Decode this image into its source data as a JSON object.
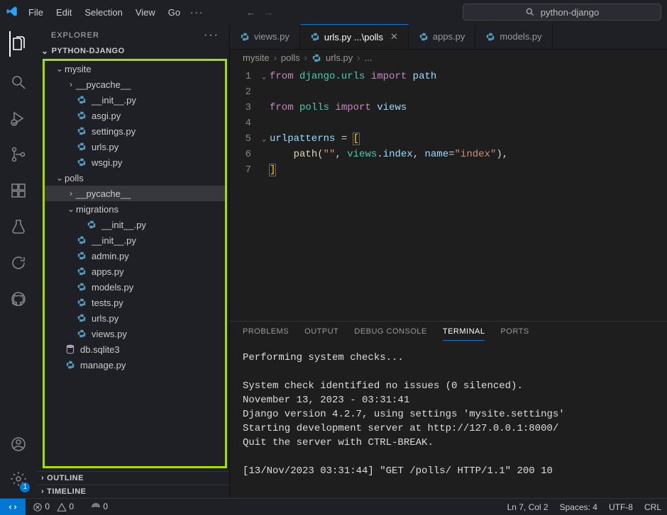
{
  "titlebar": {
    "menu": [
      "File",
      "Edit",
      "Selection",
      "View",
      "Go"
    ],
    "search": "python-django"
  },
  "sidebar": {
    "title": "EXPLORER",
    "project": "PYTHON-DJANGO",
    "outline": "OUTLINE",
    "timeline": "TIMELINE"
  },
  "tree": {
    "mysite": {
      "name": "mysite",
      "type": "folder",
      "open": true
    },
    "mysite_pycache": {
      "name": "__pycache__",
      "type": "folder",
      "open": false
    },
    "mysite_init": {
      "name": "__init__.py",
      "type": "py"
    },
    "asgi": {
      "name": "asgi.py",
      "type": "py"
    },
    "settings": {
      "name": "settings.py",
      "type": "py"
    },
    "mysite_urls": {
      "name": "urls.py",
      "type": "py"
    },
    "wsgi": {
      "name": "wsgi.py",
      "type": "py"
    },
    "polls": {
      "name": "polls",
      "type": "folder",
      "open": true
    },
    "polls_pycache": {
      "name": "__pycache__",
      "type": "folder",
      "open": false,
      "selected": true
    },
    "migrations": {
      "name": "migrations",
      "type": "folder",
      "open": true
    },
    "migrations_init": {
      "name": "__init__.py",
      "type": "py"
    },
    "polls_init": {
      "name": "__init__.py",
      "type": "py"
    },
    "admin": {
      "name": "admin.py",
      "type": "py"
    },
    "apps": {
      "name": "apps.py",
      "type": "py"
    },
    "models": {
      "name": "models.py",
      "type": "py"
    },
    "tests": {
      "name": "tests.py",
      "type": "py"
    },
    "polls_urls": {
      "name": "urls.py",
      "type": "py"
    },
    "views": {
      "name": "views.py",
      "type": "py"
    },
    "db": {
      "name": "db.sqlite3",
      "type": "db"
    },
    "manage": {
      "name": "manage.py",
      "type": "py"
    }
  },
  "tabs": {
    "views": "views.py",
    "urls": "urls.py ...\\polls",
    "apps": "apps.py",
    "models": "models.py"
  },
  "breadcrumbs": [
    "mysite",
    "polls",
    "urls.py",
    "..."
  ],
  "code": {
    "l1": {
      "kw1": "from",
      "mod": "django.urls",
      "kw2": "import",
      "id": "path"
    },
    "l3": {
      "kw1": "from",
      "mod": "polls",
      "kw2": "import",
      "id": "views"
    },
    "l5": {
      "var": "urlpatterns",
      "eq": " = ",
      "b": "["
    },
    "l6": {
      "fn": "path",
      "p1": "(",
      "s": "\"\"",
      "c1": ", ",
      "mod": "views",
      "dot": ".",
      "id": "index",
      "c2": ", ",
      "kw": "name",
      "eq2": "=",
      "s2": "\"index\"",
      "p2": "),"
    },
    "l7": {
      "b": "]"
    }
  },
  "panel": {
    "tabs": [
      "PROBLEMS",
      "OUTPUT",
      "DEBUG CONSOLE",
      "TERMINAL",
      "PORTS"
    ],
    "terminal": "Performing system checks...\n\nSystem check identified no issues (0 silenced).\nNovember 13, 2023 - 03:31:41\nDjango version 4.2.7, using settings 'mysite.settings'\nStarting development server at http://127.0.0.1:8000/\nQuit the server with CTRL-BREAK.\n\n[13/Nov/2023 03:31:44] \"GET /polls/ HTTP/1.1\" 200 10"
  },
  "status": {
    "errors": "0",
    "warnings": "0",
    "ports": "0",
    "pos": "Ln 7, Col 2",
    "spaces": "Spaces: 4",
    "enc": "UTF-8",
    "eol": "CRL"
  }
}
